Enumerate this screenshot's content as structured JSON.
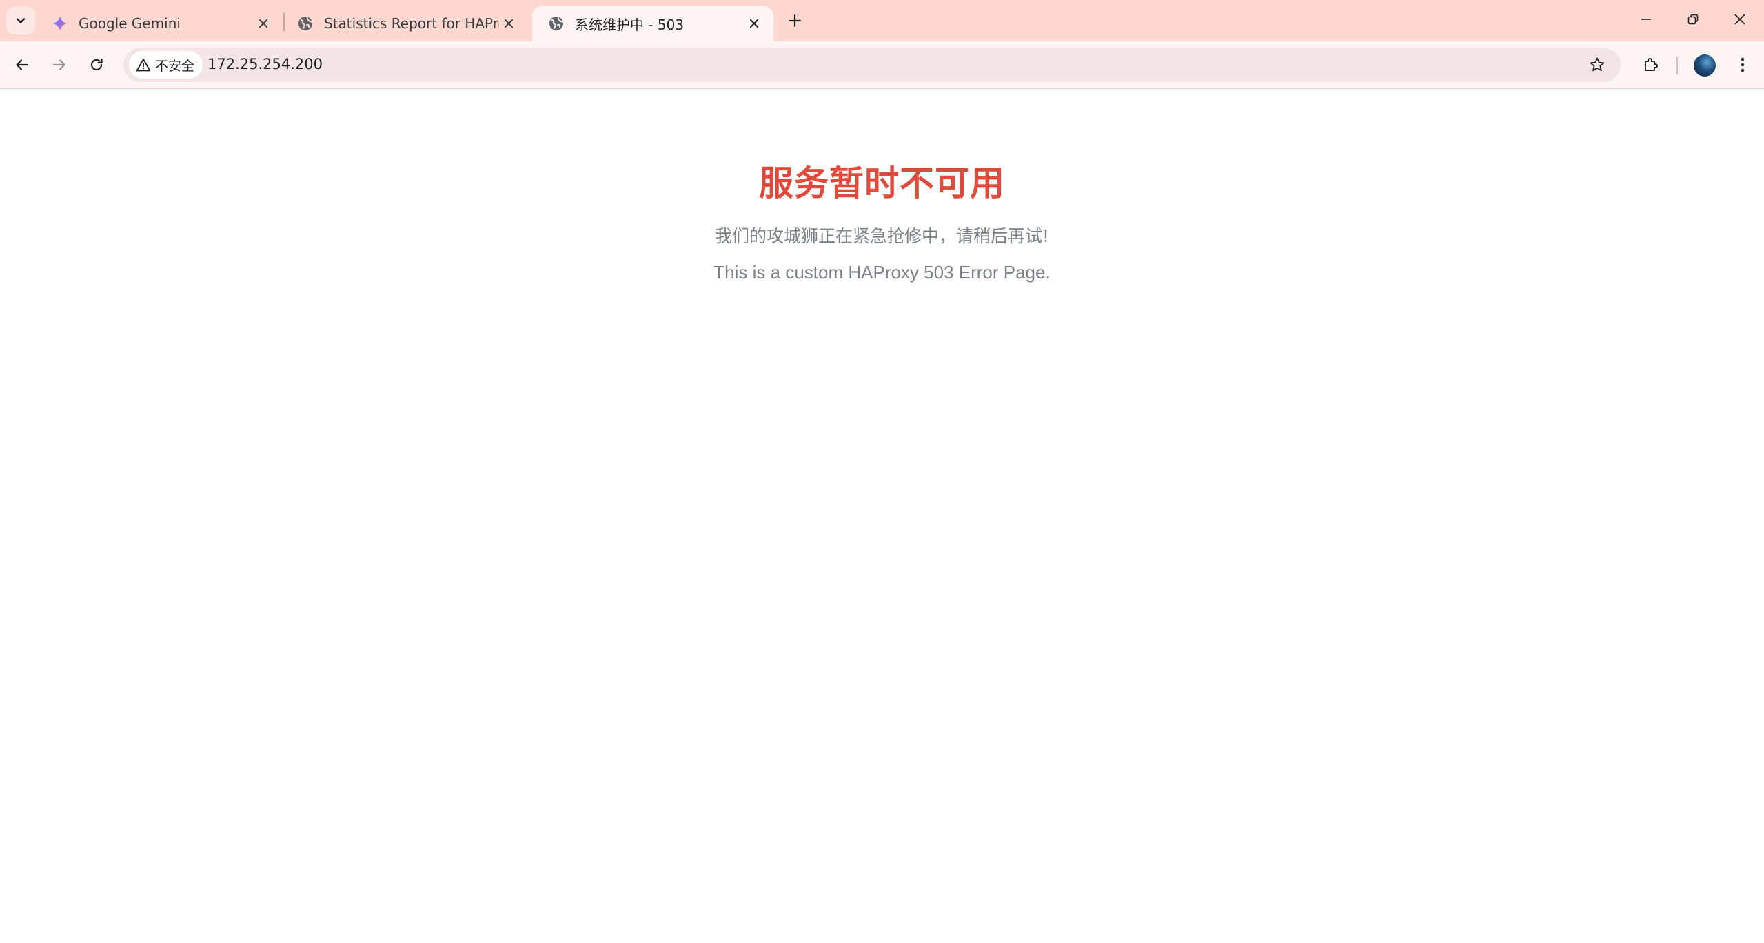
{
  "browser": {
    "tabs": [
      {
        "title": "Google Gemini",
        "favicon": "gemini-sparkle-icon",
        "active": false
      },
      {
        "title": "Statistics Report for HAProxy",
        "favicon": "globe-icon",
        "active": false
      },
      {
        "title": "系统维护中 - 503",
        "favicon": "globe-icon",
        "active": true
      }
    ],
    "address_bar": {
      "security_label": "不安全",
      "url": "172.25.254.200"
    },
    "colors": {
      "tabstrip_bg": "#fdd8d1",
      "toolbar_bg": "#fef4f2",
      "omnibox_bg": "#f3e5e3"
    }
  },
  "page": {
    "headline": "服务暂时不可用",
    "subline": "我们的攻城狮正在紧急抢修中，请稍后再试!",
    "note": "This is a custom HAProxy 503 Error Page.",
    "colors": {
      "headline": "#e04a3c",
      "body_text": "#7a8187"
    }
  }
}
